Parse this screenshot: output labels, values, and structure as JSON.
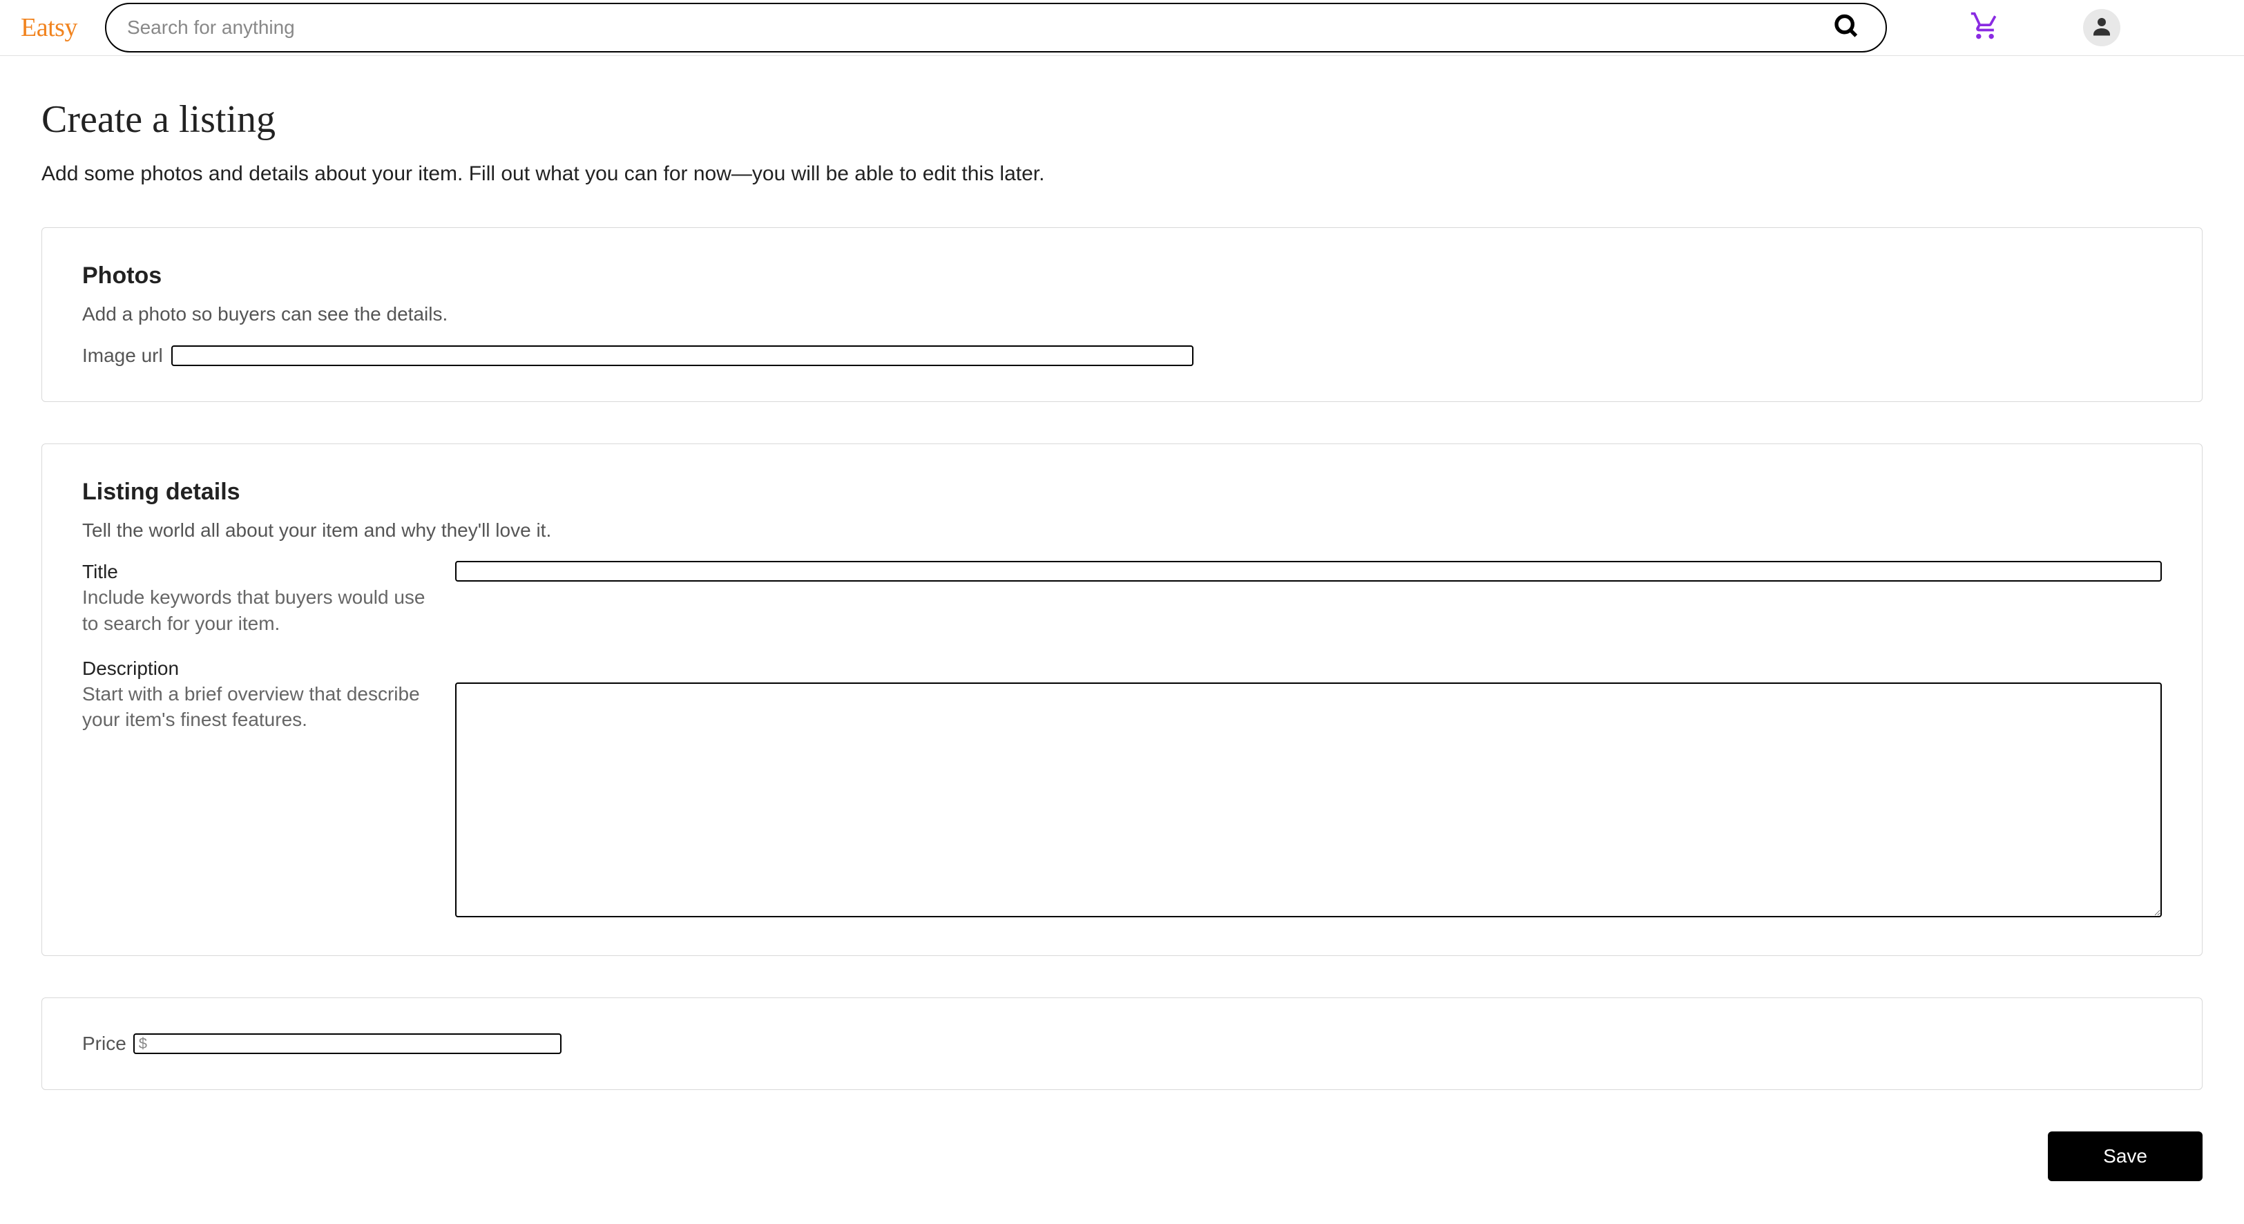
{
  "header": {
    "logo": "Eatsy",
    "search_placeholder": "Search for anything"
  },
  "page": {
    "title": "Create a listing",
    "subtitle": "Add some photos and details about your item. Fill out what you can for now—you will be able to edit this later."
  },
  "photos": {
    "title": "Photos",
    "sub": "Add a photo so buyers can see the details.",
    "image_url_label": "Image url",
    "image_url_value": ""
  },
  "details": {
    "title": "Listing details",
    "sub": "Tell the world all about your item and why they'll love it.",
    "title_field": {
      "label": "Title",
      "hint": "Include keywords that buyers would use to search for your item.",
      "value": ""
    },
    "description_field": {
      "label": "Description",
      "hint": "Start with a brief overview that describe your item's finest features.",
      "value": ""
    }
  },
  "price": {
    "label": "Price",
    "placeholder": "$",
    "value": ""
  },
  "save_label": "Save"
}
